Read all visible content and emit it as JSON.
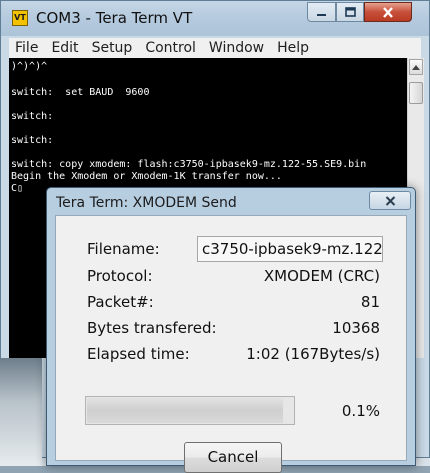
{
  "window": {
    "title": "COM3 - Tera Term VT",
    "icon_label": "VT",
    "icon_name": "teraterm-app-icon",
    "controls": [
      "minimize-icon",
      "maximize-icon",
      "close-icon"
    ],
    "close_color": "#c7503a"
  },
  "menu": {
    "items": [
      "File",
      "Edit",
      "Setup",
      "Control",
      "Window",
      "Help"
    ]
  },
  "terminal": {
    "lines": [
      ")^)^)^",
      "",
      "switch:  set BAUD  9600",
      "",
      "switch:",
      "",
      "switch:",
      "",
      "switch: copy xmodem: flash:c3750-ipbasek9-mz.122-55.SE9.bin",
      "Begin the Xmodem or Xmodem-1K transfer now...",
      "C▯"
    ]
  },
  "dialog": {
    "title": "Tera Term: XMODEM Send",
    "filename_label": "Filename:",
    "filename_value": "c3750-ipbasek9-mz.122",
    "protocol_label": "Protocol:",
    "protocol_value": "XMODEM (CRC)",
    "packet_label": "Packet#:",
    "packet_value": "81",
    "bytes_label": "Bytes transfered:",
    "bytes_value": "10368",
    "elapsed_label": "Elapsed time:",
    "elapsed_value": "1:02 (167Bytes/s)",
    "progress_text": "0.1%",
    "progress_fraction": 0.001,
    "cancel_label": "Cancel"
  }
}
